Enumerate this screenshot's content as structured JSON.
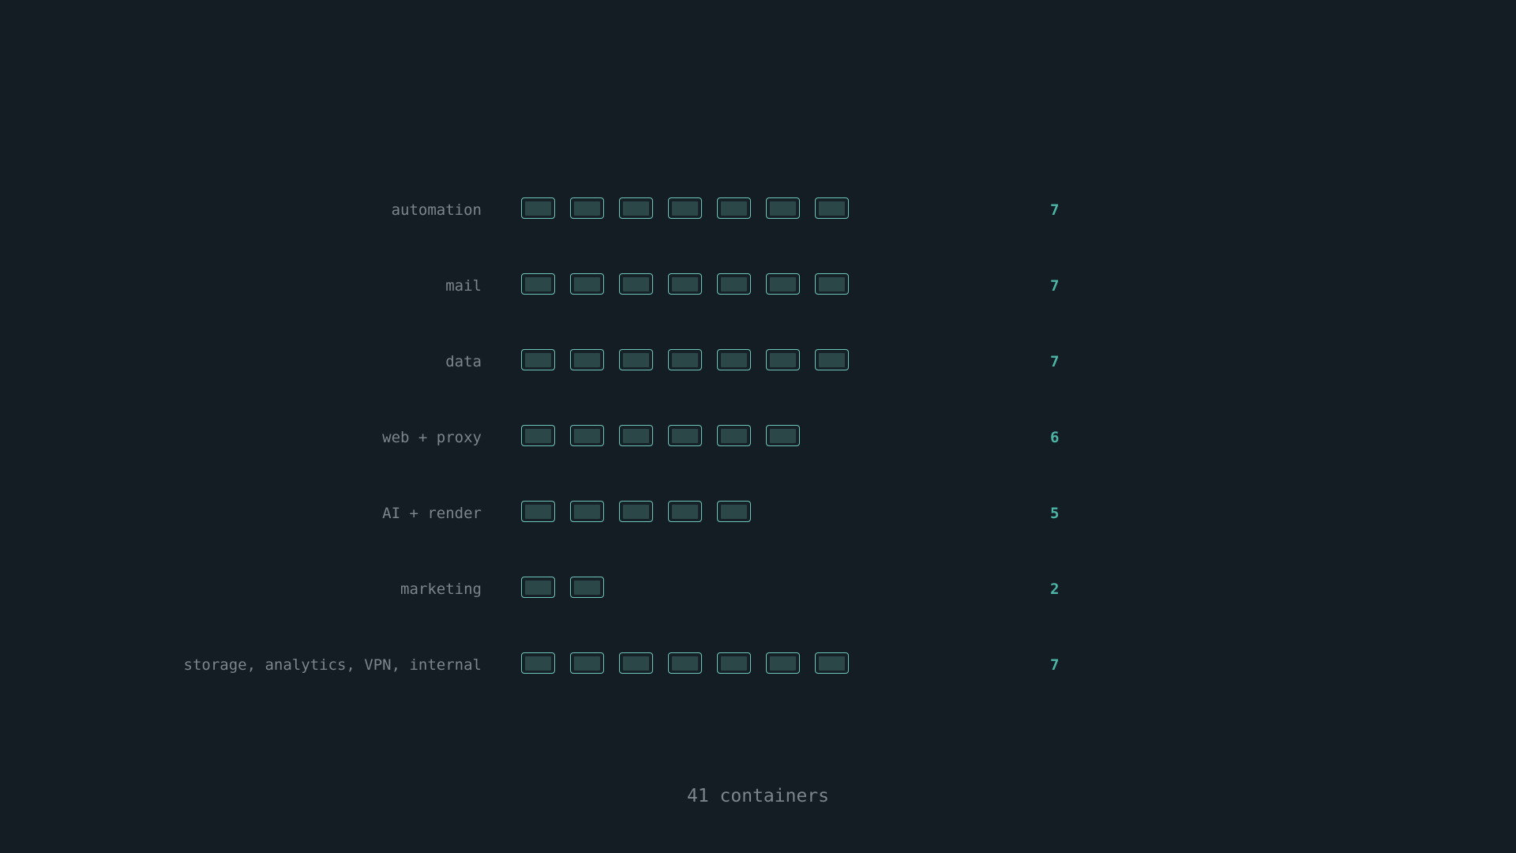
{
  "groups": [
    {
      "label": "automation",
      "count": "7",
      "boxes": 7
    },
    {
      "label": "mail",
      "count": "7",
      "boxes": 7
    },
    {
      "label": "data",
      "count": "7",
      "boxes": 7
    },
    {
      "label": "web + proxy",
      "count": "6",
      "boxes": 6
    },
    {
      "label": "AI + render",
      "count": "5",
      "boxes": 5
    },
    {
      "label": "marketing",
      "count": "2",
      "boxes": 2
    },
    {
      "label": "storage, analytics, VPN, internal",
      "count": "7",
      "boxes": 7
    }
  ],
  "total_label": "41 containers",
  "colors": {
    "background": "#141c24",
    "label": "#7d858c",
    "count": "#4cb5a6",
    "box_border": "#6fc7bc",
    "box_fill": "#2c4747"
  }
}
